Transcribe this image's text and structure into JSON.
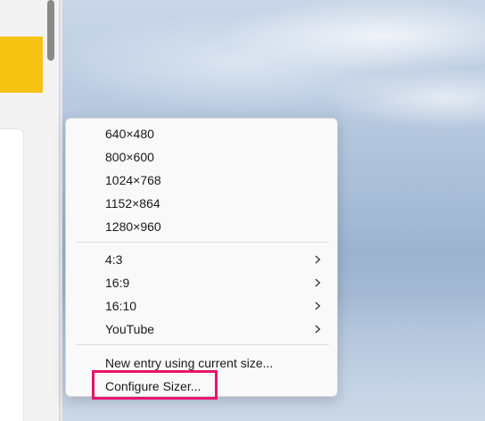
{
  "menu": {
    "sizes": [
      {
        "label": "640×480"
      },
      {
        "label": "800×600"
      },
      {
        "label": "1024×768"
      },
      {
        "label": "1152×864"
      },
      {
        "label": "1280×960"
      }
    ],
    "ratios": [
      {
        "label": "4:3",
        "icon": "chevron-right-icon"
      },
      {
        "label": "16:9",
        "icon": "chevron-right-icon"
      },
      {
        "label": "16:10",
        "icon": "chevron-right-icon"
      },
      {
        "label": "YouTube",
        "icon": "chevron-right-icon"
      }
    ],
    "actions": [
      {
        "label": "New entry using current size..."
      },
      {
        "label": "Configure Sizer..."
      }
    ]
  },
  "highlight": {
    "target": "Configure Sizer...",
    "color": "#e8136a"
  },
  "colors": {
    "app_accent": "#f7c313",
    "menu_background": "#f9f9f9"
  }
}
